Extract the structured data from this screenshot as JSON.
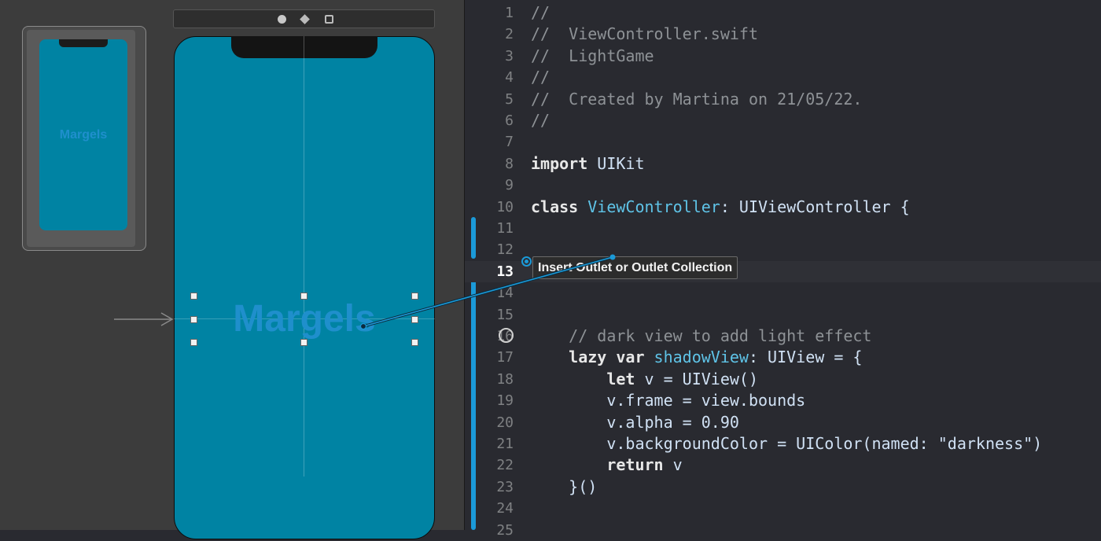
{
  "storyboard": {
    "thumbnail_label": "Margels",
    "scene_label": "Margels",
    "colors": {
      "screen": "#0083a3",
      "label": "#1f8fcc",
      "accent": "#1b9ad8"
    }
  },
  "editor": {
    "lines": [
      {
        "n": "1",
        "text": "//"
      },
      {
        "n": "2",
        "text": "//  ViewController.swift"
      },
      {
        "n": "3",
        "text": "//  LightGame"
      },
      {
        "n": "4",
        "text": "//"
      },
      {
        "n": "5",
        "text": "//  Created by Martina on 21/05/22."
      },
      {
        "n": "6",
        "text": "//"
      },
      {
        "n": "7",
        "text": ""
      },
      {
        "n": "8",
        "kw": "import",
        "rest": " UIKit"
      },
      {
        "n": "9",
        "text": ""
      },
      {
        "n": "10",
        "kw": "class",
        "decl": "ViewController",
        "rest": ": UIViewController {"
      },
      {
        "n": "11",
        "text": ""
      },
      {
        "n": "12",
        "text": ""
      },
      {
        "n": "13",
        "text": ""
      },
      {
        "n": "14",
        "text": ""
      },
      {
        "n": "15",
        "text": ""
      },
      {
        "n": "16",
        "text": "    // dark view to add light effect"
      },
      {
        "n": "17",
        "kw": "    lazy var",
        "decl": "shadowView",
        "rest": ": UIView = {"
      },
      {
        "n": "18",
        "kw": "        let",
        "rest": " v = UIView()"
      },
      {
        "n": "19",
        "text": "        v.frame = view.bounds"
      },
      {
        "n": "20",
        "text": "        v.alpha = 0.90"
      },
      {
        "n": "21",
        "text": "        v.backgroundColor = UIColor(named: \"darkness\")"
      },
      {
        "n": "22",
        "kw": "        return",
        "rest": " v"
      },
      {
        "n": "23",
        "text": "    }()"
      },
      {
        "n": "24",
        "text": ""
      },
      {
        "n": "25",
        "text": ""
      }
    ],
    "current_line": "13",
    "tooltip": "Insert Outlet or Outlet Collection"
  }
}
